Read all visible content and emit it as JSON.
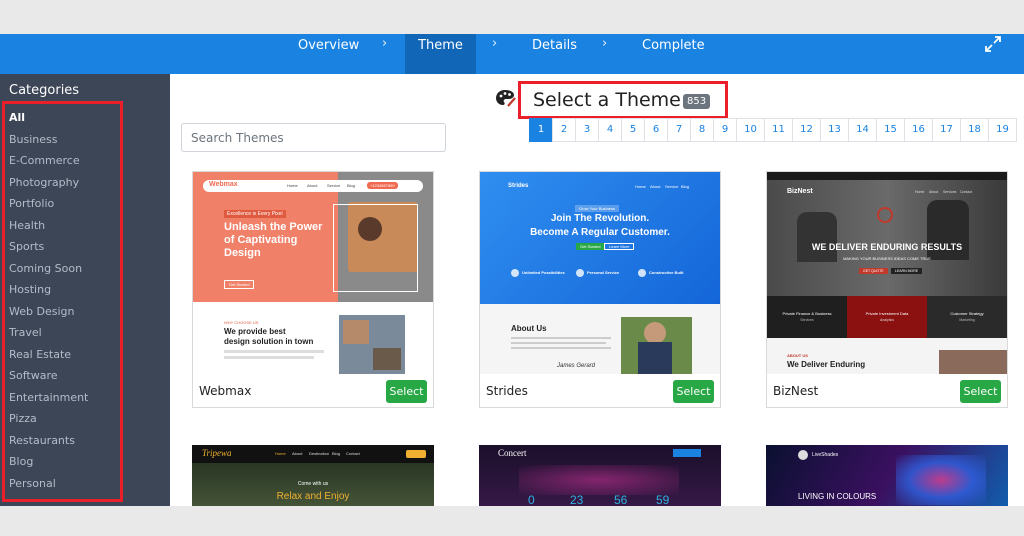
{
  "wizard": {
    "steps": [
      {
        "label": "Overview"
      },
      {
        "label": "Theme"
      },
      {
        "label": "Details"
      },
      {
        "label": "Complete"
      }
    ],
    "separator": "›",
    "active_step": "Theme",
    "accent_color": "#1a82e0"
  },
  "sidebar": {
    "title": "Categories",
    "items": [
      "All",
      "Business",
      "E-Commerce",
      "Photography",
      "Portfolio",
      "Health",
      "Sports",
      "Coming Soon",
      "Hosting",
      "Web Design",
      "Travel",
      "Real Estate",
      "Software",
      "Entertainment",
      "Pizza",
      "Restaurants",
      "Blog",
      "Personal"
    ],
    "active_item": "All"
  },
  "main": {
    "heading": "Select a Theme",
    "count": "853",
    "search": {
      "placeholder": "Search Themes",
      "value": ""
    },
    "pagination": [
      "1",
      "2",
      "3",
      "4",
      "5",
      "6",
      "7",
      "8",
      "9",
      "10",
      "11",
      "12",
      "13",
      "14",
      "15",
      "16",
      "17",
      "18",
      "19"
    ],
    "active_page": "1",
    "select_label": "Select",
    "themes": [
      {
        "name": "Webmax",
        "preview": {
          "logo": "Webmax",
          "phone": "+1234567890",
          "badge": "Excellence is Every Pixel",
          "headline": [
            "Unleash the Power",
            "of Captivating",
            "Design"
          ],
          "cta": "Get Started",
          "section_tag": "WHY CHOOSE US",
          "section_title": [
            "We provide best",
            "design solution in town"
          ],
          "nav": [
            "Home",
            "About",
            "Service",
            "Blog",
            "Contact"
          ]
        }
      },
      {
        "name": "Strides",
        "preview": {
          "logo": "Strides",
          "tag": "Grow Your Business",
          "headline": [
            "Join The Revolution.",
            "Become A Regular Customer."
          ],
          "buttons": [
            "Get Started",
            "Learn More"
          ],
          "features": [
            "Unlimited Possibilities",
            "Personal Service",
            "Constructive Built"
          ],
          "section_title": "About Us",
          "signature": "James Gerard",
          "nav": [
            "Home",
            "About",
            "Service",
            "Blog"
          ]
        }
      },
      {
        "name": "BizNest",
        "preview": {
          "logo": "BizNest",
          "headline": "WE DELIVER  ENDURING RESULTS",
          "sub": "MAKING YOUR BUSINESS IDEAS COME TRUE",
          "buttons": [
            "GET QUOTE",
            "LEARN MORE"
          ],
          "boxes": [
            {
              "title": "Private Finance & Business",
              "sub": "Services"
            },
            {
              "title": "Private Investment Data",
              "sub": "Analytics"
            },
            {
              "title": "Customer Strategy",
              "sub": "Marketing"
            }
          ],
          "section_tag": "ABOUT US",
          "section_title": "We Deliver Enduring",
          "nav": [
            "Home",
            "About",
            "Services",
            "Contact"
          ]
        }
      }
    ],
    "second_row": [
      {
        "logo": "Tripewa",
        "text": [
          "Come with us",
          "Relax and Enjoy"
        ],
        "nav": [
          "Home",
          "About",
          "Destination",
          "Blog",
          "Contact"
        ]
      },
      {
        "logo": "Concert",
        "counters": [
          "0",
          "23",
          "56",
          "59"
        ]
      },
      {
        "logo": "LiveShades",
        "text": [
          "LIVING IN COLOURS"
        ]
      }
    ]
  },
  "colors": {
    "sidebar_bg": "#3d4657",
    "highlight_border": "#ea1f2a",
    "select_button": "#28a745",
    "badge": "#6c757d"
  }
}
